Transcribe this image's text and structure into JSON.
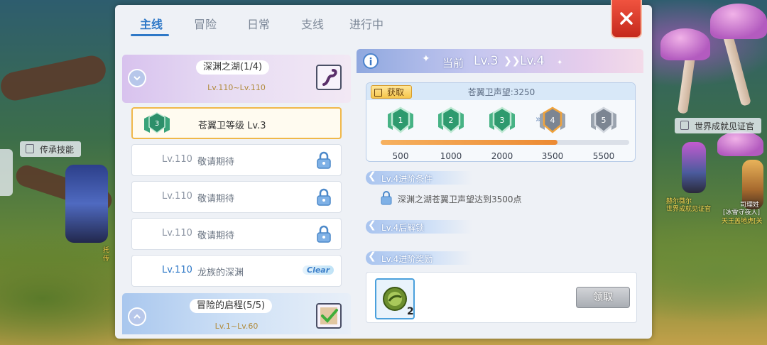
{
  "tabs": [
    "主线",
    "冒险",
    "日常",
    "支线",
    "进行中"
  ],
  "background": {
    "tag_left": "传承技能",
    "tag_right": "世界成就见证官",
    "npc_right_name1": "赫尔薇尔",
    "npc_right_title1": "世界成就见证官",
    "npc_right_name2": "司理姓",
    "npc_right_title2": "[冰雪守夜人]",
    "npc_right_title3": "天王盖地虎[关",
    "npc_left_name": "托",
    "npc_left_title": "传"
  },
  "chapters": [
    {
      "title": "深渊之湖(1/4)",
      "range": "Lv.110~Lv.110"
    },
    {
      "title": "冒险的启程(5/5)",
      "range": "Lv.1~Lv.60"
    }
  ],
  "quests": [
    {
      "badge": "3",
      "name": "苍翼卫等级 Lv.3",
      "state": "selected"
    },
    {
      "level": "Lv.110",
      "name": "敬请期待",
      "state": "locked"
    },
    {
      "level": "Lv.110",
      "name": "敬请期待",
      "state": "locked"
    },
    {
      "level": "Lv.110",
      "name": "敬请期待",
      "state": "locked"
    },
    {
      "level": "Lv.110",
      "name": "龙族的深渊",
      "state": "clear",
      "badge_text": "Clear"
    }
  ],
  "current": {
    "label": "当前",
    "from": "Lv.3",
    "to": "Lv.4"
  },
  "reputation": {
    "get_label": "获取",
    "title": "苍翼卫声望:3250",
    "levels": [
      "1",
      "2",
      "3",
      "4",
      "5"
    ],
    "thresholds": [
      "500",
      "1000",
      "2000",
      "3500",
      "5500"
    ],
    "current_value": 3250,
    "progress_fraction": 0.71
  },
  "sections": {
    "condition_title": "Lv.4进阶条件",
    "condition_text": "深渊之湖苍翼卫声望达到3500点",
    "unlock_title": "Lv.4后解锁",
    "reward_title": "Lv.4进阶奖励"
  },
  "reward": {
    "count": "2",
    "claim_label": "领取"
  },
  "colors": {
    "accent": "#2e78c7",
    "close": "#d9382a",
    "progress": "#ec8a33"
  }
}
